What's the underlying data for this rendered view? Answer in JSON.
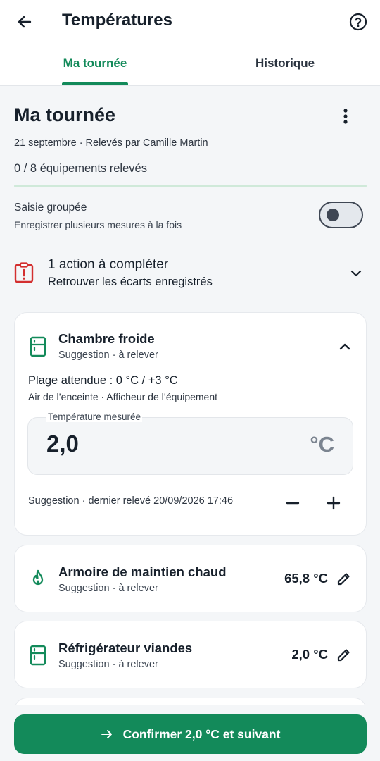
{
  "header": {
    "title": "Températures",
    "back_icon": "arrow-left-icon",
    "help_icon": "help-circle-icon"
  },
  "tabs": [
    {
      "label": "Ma tournée",
      "active": true
    },
    {
      "label": "Historique",
      "active": false
    }
  ],
  "round": {
    "title": "Ma tournée",
    "date_line": "21 septembre · Relevés par Camille Martin",
    "count_line": "0 / 8 équipements relevés",
    "progress_fraction": 0.0
  },
  "group_entry": {
    "label": "Saisie groupée",
    "description": "Enregistrer plusieurs mesures à la fois",
    "enabled": false
  },
  "alert": {
    "title": "1 action à compléter",
    "subtitle": "Retrouver les écarts enregistrés",
    "color": "#d32f2f"
  },
  "current_equipment": {
    "name": "Chambre froide",
    "status": "Suggestion · à relever",
    "expected_range": "Plage attendue : 0 °C / +3 °C",
    "sensor": "Air de l’enceinte · Afficheur de l’équipement",
    "field_label": "Température mesurée",
    "value": "2,0",
    "unit": "°C",
    "last_reading": "Suggestion · dernier relevé 20/09/2026 17:46"
  },
  "equipment_list": [
    {
      "name": "Armoire de maintien chaud",
      "status": "Suggestion · à relever",
      "temperature": "65,8 °C",
      "icon": "flame-icon"
    },
    {
      "name": "Réfrigérateur viandes",
      "status": "Suggestion · à relever",
      "temperature": "2,0 °C",
      "icon": "fridge-icon"
    }
  ],
  "confirm_button": {
    "label": "Confirmer 2,0 °C et suivant"
  },
  "colors": {
    "accent": "#138a5a",
    "alert": "#d32f2f",
    "background": "#f4f6f8"
  }
}
